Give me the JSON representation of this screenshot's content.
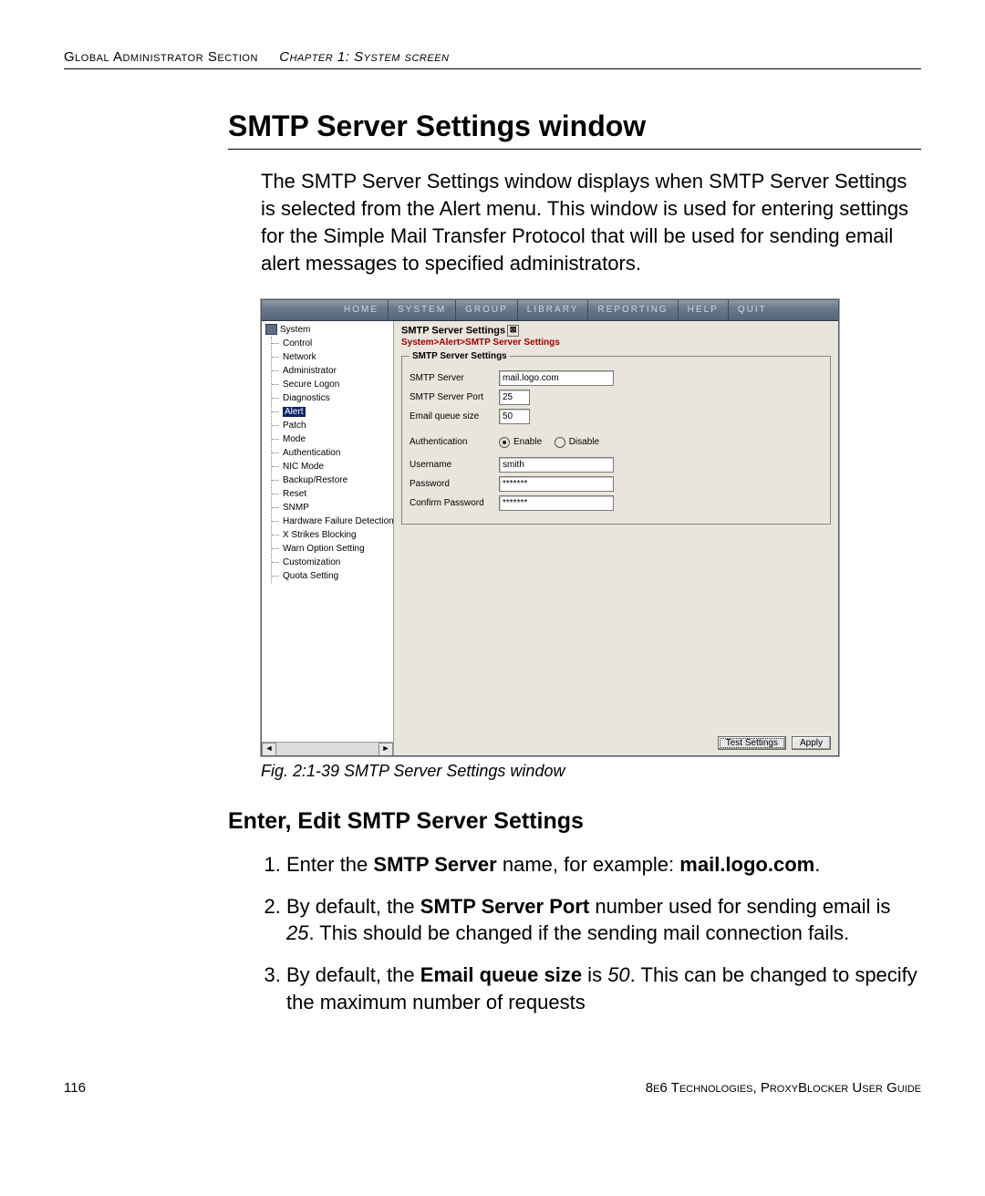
{
  "header": {
    "left": "Global Administrator Section",
    "right_prefix": "Chapter 1: ",
    "right": "System screen"
  },
  "section_title": "SMTP Server Settings window",
  "intro": "The SMTP Server Settings window displays when SMTP Server Settings is selected from the Alert menu. This window is used for entering settings for the Simple Mail Transfer Protocol that will be used for sending email alert messages to specified administrators.",
  "figure_caption": "Fig. 2:1-39  SMTP Server Settings window",
  "subsection": "Enter, Edit SMTP Server Settings",
  "steps": {
    "s1a": "Enter the ",
    "s1b": "SMTP Server",
    "s1c": " name, for example: ",
    "s1d": "mail.logo.com",
    "s1e": ".",
    "s2a": "By default, the ",
    "s2b": "SMTP Server Port",
    "s2c": " number used for sending email is ",
    "s2d": "25",
    "s2e": ". This should be changed if the sending mail connection fails.",
    "s3a": "By default, the ",
    "s3b": "Email queue size",
    "s3c": " is ",
    "s3d": "50",
    "s3e": ". This can be changed to specify the maximum number of requests"
  },
  "footer": {
    "page": "116",
    "right": "8e6 Technologies, ProxyBlocker User Guide"
  },
  "app": {
    "menu": [
      "HOME",
      "SYSTEM",
      "GROUP",
      "LIBRARY",
      "REPORTING",
      "HELP",
      "QUIT"
    ],
    "tree_root": "System",
    "tree": [
      "Control",
      "Network",
      "Administrator",
      "Secure Logon",
      "Diagnostics",
      "Alert",
      "Patch",
      "Mode",
      "Authentication",
      "NIC Mode",
      "Backup/Restore",
      "Reset",
      "SNMP",
      "Hardware Failure Detection",
      "X Strikes Blocking",
      "Warn Option Setting",
      "Customization",
      "Quota Setting"
    ],
    "tree_selected_index": 5,
    "panel_title": "SMTP Server Settings",
    "breadcrumb": "System>Alert>SMTP Server Settings",
    "group_legend": "SMTP Server Settings",
    "fields": {
      "server_label": "SMTP Server",
      "server_value": "mail.logo.com",
      "port_label": "SMTP Server Port",
      "port_value": "25",
      "queue_label": "Email queue size",
      "queue_value": "50",
      "auth_label": "Authentication",
      "auth_enable": "Enable",
      "auth_disable": "Disable",
      "auth_selected": "enable",
      "user_label": "Username",
      "user_value": "smith",
      "pass_label": "Password",
      "pass_value": "*******",
      "confirm_label": "Confirm Password",
      "confirm_value": "*******"
    },
    "buttons": {
      "test": "Test Settings",
      "apply": "Apply"
    },
    "scroll_left": "◄",
    "scroll_right": "►"
  }
}
